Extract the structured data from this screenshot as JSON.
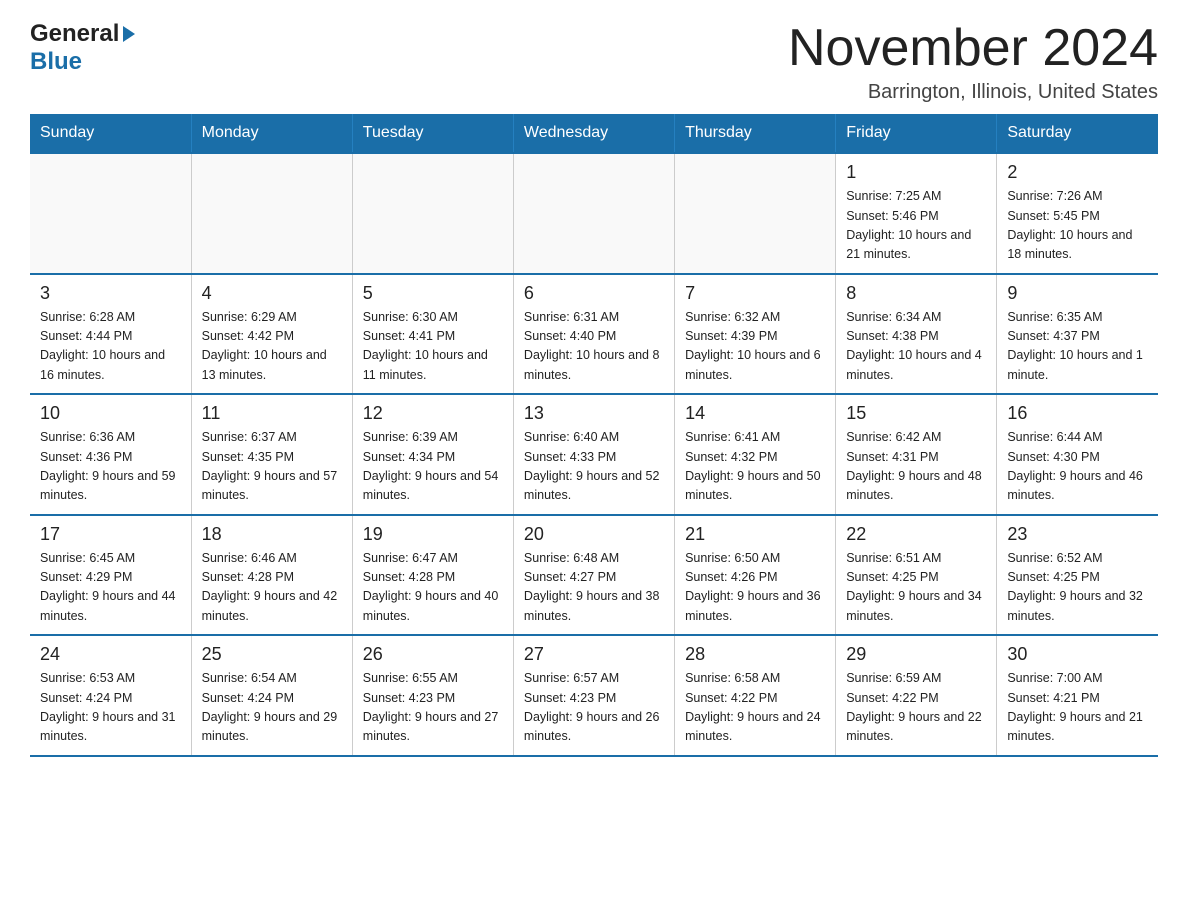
{
  "header": {
    "logo_general": "General",
    "logo_blue": "Blue",
    "month_title": "November 2024",
    "location": "Barrington, Illinois, United States"
  },
  "weekdays": [
    "Sunday",
    "Monday",
    "Tuesday",
    "Wednesday",
    "Thursday",
    "Friday",
    "Saturday"
  ],
  "rows": [
    [
      {
        "day": "",
        "sunrise": "",
        "sunset": "",
        "daylight": ""
      },
      {
        "day": "",
        "sunrise": "",
        "sunset": "",
        "daylight": ""
      },
      {
        "day": "",
        "sunrise": "",
        "sunset": "",
        "daylight": ""
      },
      {
        "day": "",
        "sunrise": "",
        "sunset": "",
        "daylight": ""
      },
      {
        "day": "",
        "sunrise": "",
        "sunset": "",
        "daylight": ""
      },
      {
        "day": "1",
        "sunrise": "Sunrise: 7:25 AM",
        "sunset": "Sunset: 5:46 PM",
        "daylight": "Daylight: 10 hours and 21 minutes."
      },
      {
        "day": "2",
        "sunrise": "Sunrise: 7:26 AM",
        "sunset": "Sunset: 5:45 PM",
        "daylight": "Daylight: 10 hours and 18 minutes."
      }
    ],
    [
      {
        "day": "3",
        "sunrise": "Sunrise: 6:28 AM",
        "sunset": "Sunset: 4:44 PM",
        "daylight": "Daylight: 10 hours and 16 minutes."
      },
      {
        "day": "4",
        "sunrise": "Sunrise: 6:29 AM",
        "sunset": "Sunset: 4:42 PM",
        "daylight": "Daylight: 10 hours and 13 minutes."
      },
      {
        "day": "5",
        "sunrise": "Sunrise: 6:30 AM",
        "sunset": "Sunset: 4:41 PM",
        "daylight": "Daylight: 10 hours and 11 minutes."
      },
      {
        "day": "6",
        "sunrise": "Sunrise: 6:31 AM",
        "sunset": "Sunset: 4:40 PM",
        "daylight": "Daylight: 10 hours and 8 minutes."
      },
      {
        "day": "7",
        "sunrise": "Sunrise: 6:32 AM",
        "sunset": "Sunset: 4:39 PM",
        "daylight": "Daylight: 10 hours and 6 minutes."
      },
      {
        "day": "8",
        "sunrise": "Sunrise: 6:34 AM",
        "sunset": "Sunset: 4:38 PM",
        "daylight": "Daylight: 10 hours and 4 minutes."
      },
      {
        "day": "9",
        "sunrise": "Sunrise: 6:35 AM",
        "sunset": "Sunset: 4:37 PM",
        "daylight": "Daylight: 10 hours and 1 minute."
      }
    ],
    [
      {
        "day": "10",
        "sunrise": "Sunrise: 6:36 AM",
        "sunset": "Sunset: 4:36 PM",
        "daylight": "Daylight: 9 hours and 59 minutes."
      },
      {
        "day": "11",
        "sunrise": "Sunrise: 6:37 AM",
        "sunset": "Sunset: 4:35 PM",
        "daylight": "Daylight: 9 hours and 57 minutes."
      },
      {
        "day": "12",
        "sunrise": "Sunrise: 6:39 AM",
        "sunset": "Sunset: 4:34 PM",
        "daylight": "Daylight: 9 hours and 54 minutes."
      },
      {
        "day": "13",
        "sunrise": "Sunrise: 6:40 AM",
        "sunset": "Sunset: 4:33 PM",
        "daylight": "Daylight: 9 hours and 52 minutes."
      },
      {
        "day": "14",
        "sunrise": "Sunrise: 6:41 AM",
        "sunset": "Sunset: 4:32 PM",
        "daylight": "Daylight: 9 hours and 50 minutes."
      },
      {
        "day": "15",
        "sunrise": "Sunrise: 6:42 AM",
        "sunset": "Sunset: 4:31 PM",
        "daylight": "Daylight: 9 hours and 48 minutes."
      },
      {
        "day": "16",
        "sunrise": "Sunrise: 6:44 AM",
        "sunset": "Sunset: 4:30 PM",
        "daylight": "Daylight: 9 hours and 46 minutes."
      }
    ],
    [
      {
        "day": "17",
        "sunrise": "Sunrise: 6:45 AM",
        "sunset": "Sunset: 4:29 PM",
        "daylight": "Daylight: 9 hours and 44 minutes."
      },
      {
        "day": "18",
        "sunrise": "Sunrise: 6:46 AM",
        "sunset": "Sunset: 4:28 PM",
        "daylight": "Daylight: 9 hours and 42 minutes."
      },
      {
        "day": "19",
        "sunrise": "Sunrise: 6:47 AM",
        "sunset": "Sunset: 4:28 PM",
        "daylight": "Daylight: 9 hours and 40 minutes."
      },
      {
        "day": "20",
        "sunrise": "Sunrise: 6:48 AM",
        "sunset": "Sunset: 4:27 PM",
        "daylight": "Daylight: 9 hours and 38 minutes."
      },
      {
        "day": "21",
        "sunrise": "Sunrise: 6:50 AM",
        "sunset": "Sunset: 4:26 PM",
        "daylight": "Daylight: 9 hours and 36 minutes."
      },
      {
        "day": "22",
        "sunrise": "Sunrise: 6:51 AM",
        "sunset": "Sunset: 4:25 PM",
        "daylight": "Daylight: 9 hours and 34 minutes."
      },
      {
        "day": "23",
        "sunrise": "Sunrise: 6:52 AM",
        "sunset": "Sunset: 4:25 PM",
        "daylight": "Daylight: 9 hours and 32 minutes."
      }
    ],
    [
      {
        "day": "24",
        "sunrise": "Sunrise: 6:53 AM",
        "sunset": "Sunset: 4:24 PM",
        "daylight": "Daylight: 9 hours and 31 minutes."
      },
      {
        "day": "25",
        "sunrise": "Sunrise: 6:54 AM",
        "sunset": "Sunset: 4:24 PM",
        "daylight": "Daylight: 9 hours and 29 minutes."
      },
      {
        "day": "26",
        "sunrise": "Sunrise: 6:55 AM",
        "sunset": "Sunset: 4:23 PM",
        "daylight": "Daylight: 9 hours and 27 minutes."
      },
      {
        "day": "27",
        "sunrise": "Sunrise: 6:57 AM",
        "sunset": "Sunset: 4:23 PM",
        "daylight": "Daylight: 9 hours and 26 minutes."
      },
      {
        "day": "28",
        "sunrise": "Sunrise: 6:58 AM",
        "sunset": "Sunset: 4:22 PM",
        "daylight": "Daylight: 9 hours and 24 minutes."
      },
      {
        "day": "29",
        "sunrise": "Sunrise: 6:59 AM",
        "sunset": "Sunset: 4:22 PM",
        "daylight": "Daylight: 9 hours and 22 minutes."
      },
      {
        "day": "30",
        "sunrise": "Sunrise: 7:00 AM",
        "sunset": "Sunset: 4:21 PM",
        "daylight": "Daylight: 9 hours and 21 minutes."
      }
    ]
  ]
}
